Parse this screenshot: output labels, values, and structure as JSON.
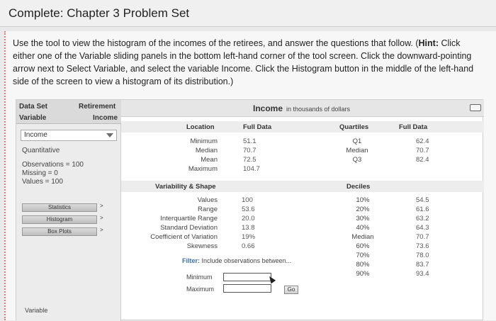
{
  "header": {
    "title": "Complete: Chapter 3 Problem Set"
  },
  "instructions": {
    "text_before_hint": "Use the tool to view the histogram of the incomes of the retirees, and answer the questions that follow. (",
    "hint_label": "Hint:",
    "text_after_hint": " Click either one of the Variable sliding panels in the bottom left-hand corner of the tool screen. Click the downward-pointing arrow next to Select Variable, and select the variable Income. Click the Histogram button in the middle of the left-hand side of the screen to view a histogram of its distribution.)"
  },
  "left_panel": {
    "dataset_label": "Data Set",
    "dataset_value": "Retirement",
    "variable_label": "Variable",
    "variable_value": "Income",
    "select_value": "Income",
    "type": "Quantitative",
    "observations": "Observations = 100",
    "missing": "Missing = 0",
    "values": "Values = 100",
    "buttons": [
      {
        "label": "Statistics"
      },
      {
        "label": "Histogram"
      },
      {
        "label": "Box Plots"
      }
    ],
    "bottom_label": "Variable"
  },
  "main": {
    "title_main": "Income",
    "title_sub": "in thousands of dollars",
    "location": {
      "header": "Location",
      "full_data_header": "Full Data",
      "rows": [
        {
          "label": "Minimum",
          "value": "51.1"
        },
        {
          "label": "Median",
          "value": "70.7"
        },
        {
          "label": "Mean",
          "value": "72.5"
        },
        {
          "label": "Maximum",
          "value": "104.7"
        }
      ]
    },
    "quartiles": {
      "header": "Quartiles",
      "full_data_header": "Full Data",
      "rows": [
        {
          "label": "Q1",
          "value": "62.4"
        },
        {
          "label": "Median",
          "value": "70.7"
        },
        {
          "label": "Q3",
          "value": "82.4"
        }
      ]
    },
    "variability": {
      "header": "Variability & Shape",
      "rows": [
        {
          "label": "Values",
          "value": "100"
        },
        {
          "label": "Range",
          "value": "53.6"
        },
        {
          "label": "Interquartile Range",
          "value": "20.0"
        },
        {
          "label": "Standard Deviation",
          "value": "13.8"
        },
        {
          "label": "Coefficient of Variation",
          "value": "19%"
        },
        {
          "label": "Skewness",
          "value": "0.66"
        }
      ]
    },
    "deciles": {
      "header": "Deciles",
      "rows": [
        {
          "label": "10%",
          "value": "54.5"
        },
        {
          "label": "20%",
          "value": "61.6"
        },
        {
          "label": "30%",
          "value": "63.2"
        },
        {
          "label": "40%",
          "value": "64.3"
        },
        {
          "label": "Median",
          "value": "70.7"
        },
        {
          "label": "60%",
          "value": "73.6"
        },
        {
          "label": "70%",
          "value": "78.0"
        },
        {
          "label": "80%",
          "value": "83.7"
        },
        {
          "label": "90%",
          "value": "93.4"
        }
      ]
    },
    "filter": {
      "label": "Filter:",
      "text": "Include observations between...",
      "minimum_label": "Minimum",
      "maximum_label": "Maximum",
      "minimum_value": "",
      "maximum_value": "",
      "go_label": "Go"
    }
  }
}
